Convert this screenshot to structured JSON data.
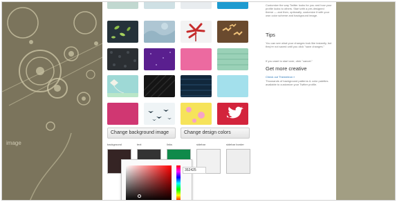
{
  "background": {
    "watermark": "image"
  },
  "colors": {
    "frame_bg": "#9c987f",
    "selected_outline": "#3f8fd0",
    "link": "#2a76b8"
  },
  "themes": {
    "tiles": [
      {
        "name": "top-row-1",
        "color": "#c1d8d0"
      },
      {
        "name": "top-row-2",
        "color": "#cfe0e4"
      },
      {
        "name": "top-row-3",
        "color": "#e8ecef"
      },
      {
        "name": "top-row-4",
        "color": "#1d9bd0"
      },
      {
        "name": "leaves",
        "color": "#25323a"
      },
      {
        "name": "blue-texture",
        "color": "#aec6d3"
      },
      {
        "name": "red-flower",
        "color": "#f3f3f3"
      },
      {
        "name": "birds-orange",
        "color": "#6a4a2e"
      },
      {
        "name": "dark-dots",
        "color": "#2b2f33"
      },
      {
        "name": "purple-stars",
        "color": "#5a1f8f"
      },
      {
        "name": "pink",
        "color": "#ec6aa0"
      },
      {
        "name": "green-pattern",
        "color": "#9ad1b7"
      },
      {
        "name": "teal-kite",
        "color": "#9ed9d6"
      },
      {
        "name": "black-diagonal",
        "color": "#151515"
      },
      {
        "name": "navy-stripes",
        "color": "#11283c"
      },
      {
        "name": "light-cyan",
        "color": "#a3e0ec"
      },
      {
        "name": "magenta",
        "color": "#c72f6b"
      },
      {
        "name": "birds-sky",
        "color": "#eff4f6"
      },
      {
        "name": "yellow-flowers",
        "color": "#f6e35a"
      },
      {
        "name": "red-bird",
        "color": "#d3243c"
      }
    ]
  },
  "buttons": {
    "change_background": "Change background image",
    "change_colors": "Change design colors"
  },
  "swatches": [
    {
      "label": "background",
      "color": "#352424"
    },
    {
      "label": "text",
      "color": "#333333"
    },
    {
      "label": "links",
      "color": "#0f8a4a"
    },
    {
      "label": "sidebar",
      "color": "#f1f1f1"
    },
    {
      "label": "sidebar border",
      "color": "#eeeeee"
    }
  ],
  "picker": {
    "hex": "352425"
  },
  "sidebar": {
    "intro": "Customize the way Twitter looks for you and how your profile looks to others. Start with a pre-designed theme — and then, optionally, customize it with your own color scheme and background image.",
    "tips_title": "Tips",
    "tips_body": "You can see what your changes look like instantly, but they're not saved until you click \"save changes.\"",
    "tips_cancel": "If you want to start over, click \"cancel.\"",
    "creative_title": "Get more creative",
    "creative_link": "Check out Themeleon »",
    "creative_body": "Thousands of background patterns & color palettes available to customize your Twitter profile."
  }
}
